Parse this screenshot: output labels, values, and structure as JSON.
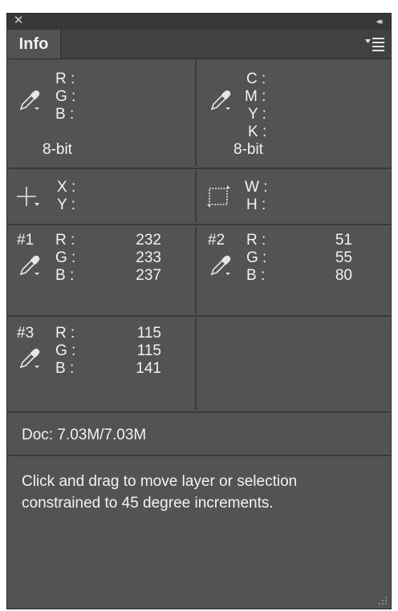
{
  "window": {
    "close_glyph": "✕",
    "collapse_glyph": "◂◂"
  },
  "tabs": [
    {
      "label": "Info"
    }
  ],
  "color_readouts": {
    "rgb": {
      "labels": [
        "R :",
        "G :",
        "B :"
      ],
      "bit_depth": "8-bit"
    },
    "cmyk": {
      "labels": [
        "C :",
        "M :",
        "Y :",
        "K :"
      ],
      "bit_depth": "8-bit"
    }
  },
  "position": {
    "x_label": "X :",
    "y_label": "Y :"
  },
  "size": {
    "w_label": "W :",
    "h_label": "H :"
  },
  "samplers": [
    {
      "id": "#1",
      "labels": [
        "R :",
        "G :",
        "B :"
      ],
      "values": [
        "232",
        "233",
        "237"
      ]
    },
    {
      "id": "#2",
      "labels": [
        "R :",
        "G :",
        "B :"
      ],
      "values": [
        "51",
        "55",
        "80"
      ]
    },
    {
      "id": "#3",
      "labels": [
        "R :",
        "G :",
        "B :"
      ],
      "values": [
        "115",
        "115",
        "141"
      ]
    }
  ],
  "doc_info": "Doc: 7.03M/7.03M",
  "hint": "Click and drag to move layer or selection constrained to 45 degree increments.",
  "icons": {
    "eyedropper": "eyedropper-icon",
    "crosshair": "crosshair-icon",
    "marquee": "marquee-size-icon",
    "menu": "panel-menu-icon"
  },
  "colors": {
    "panel_bg": "#535353",
    "header_bg": "#383838",
    "divider": "#3a3a3a",
    "text": "#f2f2f2"
  }
}
